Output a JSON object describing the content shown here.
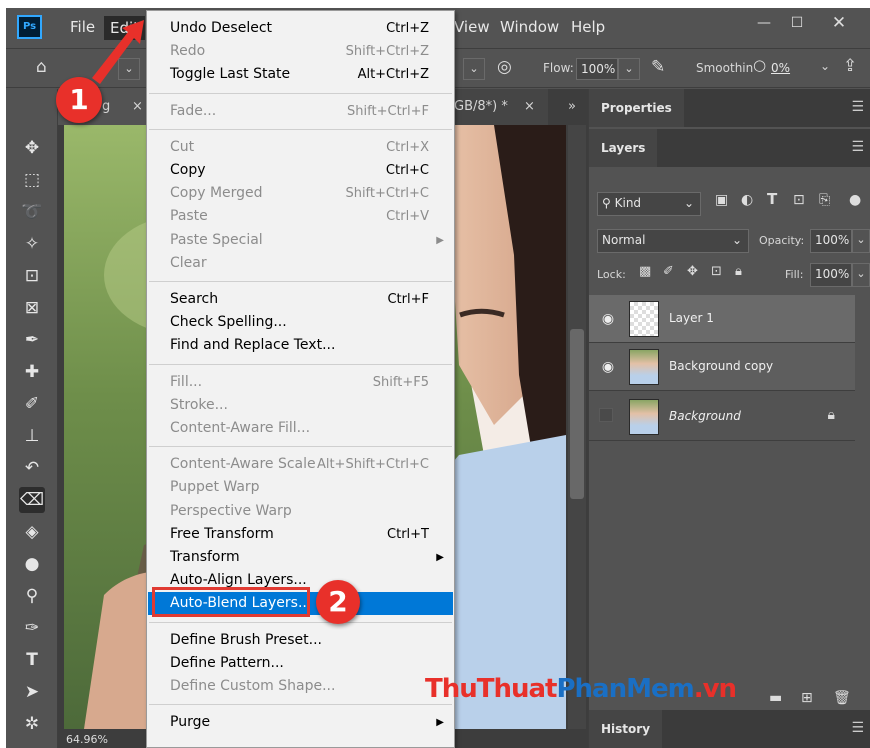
{
  "app": {
    "logo": "Ps"
  },
  "menubar": {
    "items": [
      "File",
      "Edit",
      "View",
      "Window",
      "Help"
    ]
  },
  "options": {
    "flow_label": "Flow:",
    "flow_value": "100%",
    "smoothing_label": "Smoothin",
    "smoothing_value": "0%"
  },
  "doc_tabs": [
    {
      "label": "g",
      "close": "×"
    },
    {
      "label": "GB/8*) *",
      "close": "×"
    }
  ],
  "doc": {
    "tab_overflow": "»",
    "zoom": "64.96%"
  },
  "menu": {
    "groups": [
      [
        {
          "label": "Undo Deselect",
          "shortcut": "Ctrl+Z",
          "enabled": true
        },
        {
          "label": "Redo",
          "shortcut": "Shift+Ctrl+Z",
          "enabled": false
        },
        {
          "label": "Toggle Last State",
          "shortcut": "Alt+Ctrl+Z",
          "enabled": true
        }
      ],
      [
        {
          "label": "Fade...",
          "shortcut": "Shift+Ctrl+F",
          "enabled": false
        }
      ],
      [
        {
          "label": "Cut",
          "shortcut": "Ctrl+X",
          "enabled": false
        },
        {
          "label": "Copy",
          "shortcut": "Ctrl+C",
          "enabled": true
        },
        {
          "label": "Copy Merged",
          "shortcut": "Shift+Ctrl+C",
          "enabled": false
        },
        {
          "label": "Paste",
          "shortcut": "Ctrl+V",
          "enabled": false
        },
        {
          "label": "Paste Special",
          "submenu": true,
          "enabled": false
        },
        {
          "label": "Clear",
          "enabled": false
        }
      ],
      [
        {
          "label": "Search",
          "shortcut": "Ctrl+F",
          "enabled": true
        },
        {
          "label": "Check Spelling...",
          "enabled": true
        },
        {
          "label": "Find and Replace Text...",
          "enabled": true
        }
      ],
      [
        {
          "label": "Fill...",
          "shortcut": "Shift+F5",
          "enabled": false
        },
        {
          "label": "Stroke...",
          "enabled": false
        },
        {
          "label": "Content-Aware Fill...",
          "enabled": false
        }
      ],
      [
        {
          "label": "Content-Aware Scale",
          "shortcut": "Alt+Shift+Ctrl+C",
          "enabled": false
        },
        {
          "label": "Puppet Warp",
          "enabled": false
        },
        {
          "label": "Perspective Warp",
          "enabled": false
        },
        {
          "label": "Free Transform",
          "shortcut": "Ctrl+T",
          "enabled": true
        },
        {
          "label": "Transform",
          "submenu": true,
          "enabled": true
        },
        {
          "label": "Auto-Align Layers...",
          "enabled": true
        },
        {
          "label": "Auto-Blend Layers...",
          "enabled": true,
          "highlighted": true
        }
      ],
      [
        {
          "label": "Define Brush Preset...",
          "enabled": true
        },
        {
          "label": "Define Pattern...",
          "enabled": true
        },
        {
          "label": "Define Custom Shape...",
          "enabled": false
        }
      ],
      [
        {
          "label": "Purge",
          "submenu": true,
          "enabled": true
        }
      ]
    ]
  },
  "panels": {
    "properties": "Properties",
    "layers_tab": "Layers",
    "filter_kind": "Kind",
    "blend_mode": "Normal",
    "opacity_label": "Opacity:",
    "opacity_value": "100%",
    "lock_label": "Lock:",
    "fill_label": "Fill:",
    "fill_value": "100%",
    "layers": [
      {
        "name": "Layer 1",
        "visible": true,
        "selected": true
      },
      {
        "name": "Background copy",
        "visible": true,
        "selected": true
      },
      {
        "name": "Background",
        "visible": false,
        "locked": true,
        "italic": true
      }
    ],
    "history": "History"
  },
  "annotations": {
    "callout_1": "1",
    "callout_2": "2"
  },
  "watermark": {
    "part1": "ThuThuat",
    "part2": "PhanMem",
    "part3": ".vn"
  },
  "colors": {
    "highlight": "#0078d7",
    "callout": "#e8302a",
    "ps_blue": "#31a8ff"
  }
}
